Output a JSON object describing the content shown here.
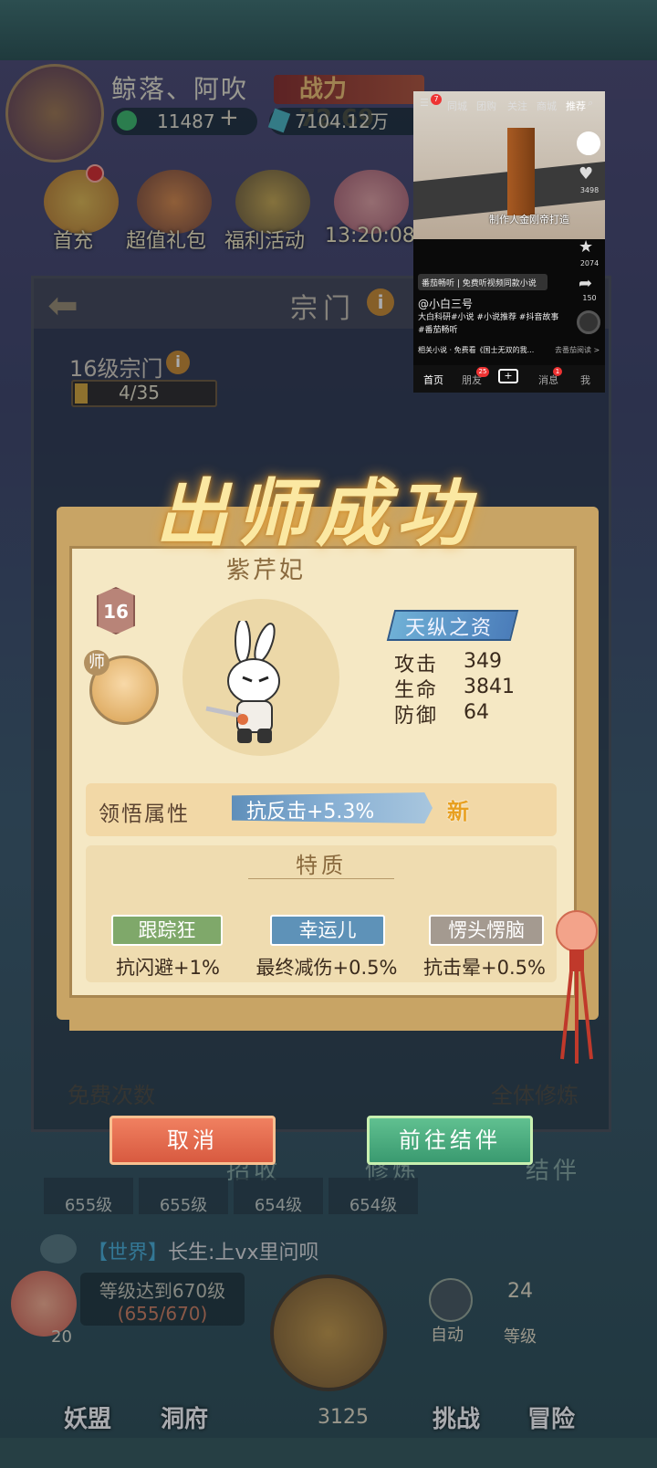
{
  "player": {
    "name": "鲸落、阿吹",
    "power": "战力 72.69",
    "coins": "11487",
    "gems": "7104.12万"
  },
  "events": [
    {
      "label": "首充"
    },
    {
      "label": "超值礼包"
    },
    {
      "label": "福利活动"
    },
    {
      "label": "13:20:08"
    }
  ],
  "sect": {
    "title": "宗门",
    "level": "16级宗门",
    "progress_text": "4/35",
    "progress": 0.114
  },
  "modal": {
    "title": "出师成功",
    "character": {
      "name": "紫芹妃",
      "level": "16",
      "master_tag": "师"
    },
    "talent": "天纵之资",
    "stats": [
      {
        "label": "攻击",
        "value": "349"
      },
      {
        "label": "生命",
        "value": "3841"
      },
      {
        "label": "防御",
        "value": "64"
      }
    ],
    "insight": {
      "label": "领悟属性",
      "value": "抗反击+5.3%",
      "new_tag": "新"
    },
    "traits_title": "特质",
    "traits": [
      {
        "name": "跟踪狂",
        "effect": "抗闪避+1%",
        "color": "#7fa86a"
      },
      {
        "name": "幸运儿",
        "effect": "最终减伤+0.5%",
        "color": "#5e92b8"
      },
      {
        "name": "愣头愣脑",
        "effect": "抗击晕+0.5%",
        "color": "#a49a90"
      }
    ],
    "cancel_label": "取消",
    "go_label": "前往结伴"
  },
  "background": {
    "free_times": "免费次数",
    "cultivate_all": "全体修炼"
  },
  "tabs": [
    "招收",
    "修炼",
    "结伴"
  ],
  "level_cards": [
    "655级",
    "655级",
    "654级",
    "654级"
  ],
  "chat": {
    "channel": "【世界】",
    "text": "长生:上vx里问呗"
  },
  "level_goal": {
    "line1": "等级达到670级",
    "line2": "(655/670)",
    "count": "20"
  },
  "axe_count": "3125",
  "auto_label": "自动",
  "level_24": {
    "value": "24",
    "label": "等级"
  },
  "bottom_nav": [
    "妖盟",
    "洞府",
    "挑战",
    "冒险"
  ],
  "pip": {
    "top_nav": [
      "同城",
      "团购",
      "关注",
      "商城",
      "推荐"
    ],
    "top_badge": "7",
    "caption": "制作人金刚帝打造",
    "like_count": "3498",
    "fav_count": "2074",
    "share_count": "150",
    "app_tag": "番茄畅听 | 免费听视频同款小说",
    "author": "@小白三号",
    "desc1": "大白科研#小说 #小说推荐 #抖音故事",
    "desc2": "#番茄畅听",
    "related": "相关小说 · 免费看《国士无双的我...",
    "related_go": "去番茄阅读 >",
    "bottom_tabs": [
      "首页",
      "朋友",
      "+",
      "消息",
      "我"
    ],
    "friend_badge": "25",
    "msg_badge": "1"
  }
}
